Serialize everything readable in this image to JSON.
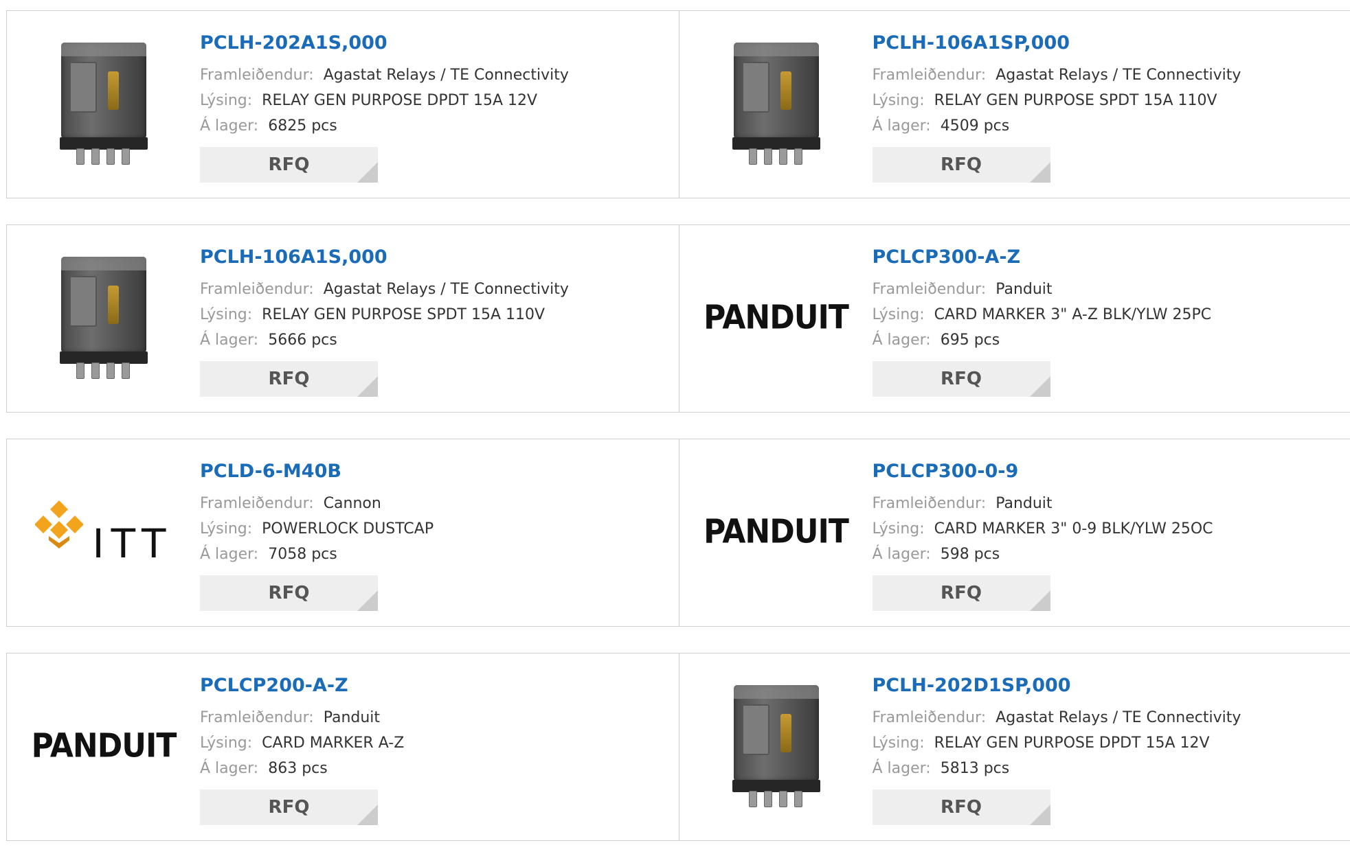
{
  "labels": {
    "manufacturer": "Framleiðendur:",
    "description": "Lýsing:",
    "stock": "Á lager:",
    "rfq": "RFQ"
  },
  "products": [
    {
      "pn": "PCLH-202A1S,000",
      "manufacturer": "Agastat Relays / TE Connectivity",
      "description": "RELAY GEN PURPOSE DPDT 15A 12V",
      "stock": "6825 pcs",
      "image": "relay-icon"
    },
    {
      "pn": "PCLH-106A1SP,000",
      "manufacturer": "Agastat Relays / TE Connectivity",
      "description": "RELAY GEN PURPOSE SPDT 15A 110V",
      "stock": "4509 pcs",
      "image": "relay-icon"
    },
    {
      "pn": "PCLH-106A1S,000",
      "manufacturer": "Agastat Relays / TE Connectivity",
      "description": "RELAY GEN PURPOSE SPDT 15A 110V",
      "stock": "5666 pcs",
      "image": "relay-icon"
    },
    {
      "pn": "PCLCP300-A-Z",
      "manufacturer": "Panduit",
      "description": "CARD MARKER 3\" A-Z BLK/YLW 25PC",
      "stock": "695 pcs",
      "image": "panduit-logo",
      "logo_text": "PANDUIT"
    },
    {
      "pn": "PCLD-6-M40B",
      "manufacturer": "Cannon",
      "description": "POWERLOCK DUSTCAP",
      "stock": "7058 pcs",
      "image": "itt-logo",
      "logo_text": "ITT"
    },
    {
      "pn": "PCLCP300-0-9",
      "manufacturer": "Panduit",
      "description": "CARD MARKER 3\" 0-9 BLK/YLW 25OC",
      "stock": "598 pcs",
      "image": "panduit-logo",
      "logo_text": "PANDUIT"
    },
    {
      "pn": "PCLCP200-A-Z",
      "manufacturer": "Panduit",
      "description": "CARD MARKER A-Z",
      "stock": "863 pcs",
      "image": "panduit-logo",
      "logo_text": "PANDUIT"
    },
    {
      "pn": "PCLH-202D1SP,000",
      "manufacturer": "Agastat Relays / TE Connectivity",
      "description": "RELAY GEN PURPOSE DPDT 15A 12V",
      "stock": "5813 pcs",
      "image": "relay-icon"
    }
  ],
  "colors": {
    "link": "#1a6bb8",
    "label": "#999999",
    "border": "#cfcfcf",
    "button_bg": "#eeeeee"
  }
}
